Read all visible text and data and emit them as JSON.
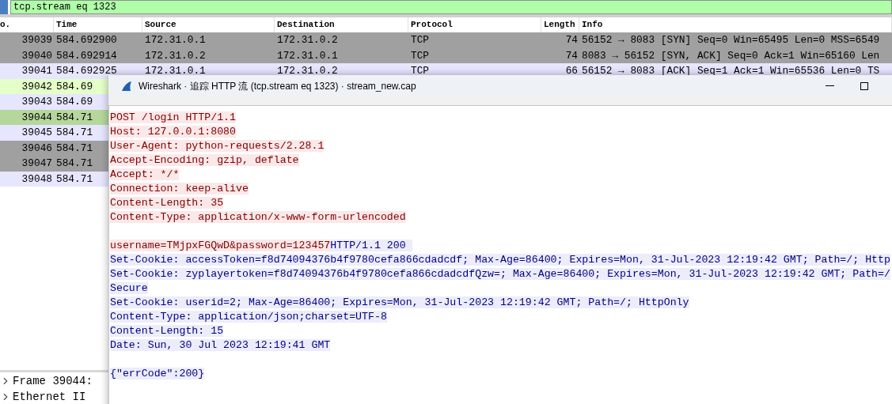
{
  "filter": {
    "value": "tcp.stream eq 1323"
  },
  "packet_list": {
    "columns": [
      "o.",
      "Time",
      "Source",
      "Destination",
      "Protocol",
      "Length",
      "Info"
    ],
    "rows": [
      {
        "no": "39039",
        "time": "584.692900",
        "source": "172.31.0.1",
        "destination": "172.31.0.2",
        "protocol": "TCP",
        "length": "74",
        "info": "56152 → 8083 [SYN] Seq=0 Win=65495 Len=0 MSS=6549",
        "color": "#a0a0a0"
      },
      {
        "no": "39040",
        "time": "584.692914",
        "source": "172.31.0.2",
        "destination": "172.31.0.1",
        "protocol": "TCP",
        "length": "74",
        "info": "8083 → 56152 [SYN, ACK] Seq=0 Ack=1 Win=65160 Len",
        "color": "#a0a0a0"
      },
      {
        "no": "39041",
        "time": "584.692925",
        "source": "172.31.0.1",
        "destination": "172.31.0.2",
        "protocol": "TCP",
        "length": "66",
        "info": "56152 → 8083 [ACK] Seq=1 Ack=1 Win=65536 Len=0 TS",
        "color": "#e7e6ff"
      },
      {
        "no": "39042",
        "time": "584.69",
        "color": "#e4ffc7"
      },
      {
        "no": "39043",
        "time": "584.69",
        "color": "#e7e6ff"
      },
      {
        "no": "39044",
        "time": "584.71",
        "color": "#b5d79c"
      },
      {
        "no": "39045",
        "time": "584.71",
        "color": "#e7e6ff"
      },
      {
        "no": "39046",
        "time": "584.71",
        "color": "#a0a0a0"
      },
      {
        "no": "39047",
        "time": "584.71",
        "color": "#a0a0a0"
      },
      {
        "no": "39048",
        "time": "584.71",
        "color": "#e7e6ff"
      }
    ]
  },
  "details": [
    {
      "label": "Frame 39044:",
      "expanded": false
    },
    {
      "label": "Ethernet II",
      "expanded": false
    }
  ],
  "dialog": {
    "title": "Wireshark · 追踪 HTTP 流 (tcp.stream eq 1323) · stream_new.cap",
    "lines": [
      {
        "kind": "text",
        "segments": [
          {
            "text": "POST /login HTTP/1.1",
            "kind": "client"
          }
        ]
      },
      {
        "kind": "text",
        "segments": [
          {
            "text": "Host: 127.0.0.1:8080",
            "kind": "client"
          }
        ]
      },
      {
        "kind": "text",
        "segments": [
          {
            "text": "User-Agent: python-requests/2.28.1",
            "kind": "client"
          }
        ]
      },
      {
        "kind": "text",
        "segments": [
          {
            "text": "Accept-Encoding: gzip, deflate",
            "kind": "client"
          }
        ]
      },
      {
        "kind": "text",
        "segments": [
          {
            "text": "Accept: */*",
            "kind": "client"
          }
        ]
      },
      {
        "kind": "text",
        "segments": [
          {
            "text": "Connection: keep-alive",
            "kind": "client"
          }
        ]
      },
      {
        "kind": "text",
        "segments": [
          {
            "text": "Content-Length: 35",
            "kind": "client"
          }
        ]
      },
      {
        "kind": "text",
        "segments": [
          {
            "text": "Content-Type: application/x-www-form-urlencoded",
            "kind": "client"
          }
        ]
      },
      {
        "kind": "blank"
      },
      {
        "kind": "text",
        "segments": [
          {
            "text": "username=TMjpxFGQwD&password=123457",
            "kind": "client"
          },
          {
            "text": "HTTP/1.1 200 ",
            "kind": "server"
          }
        ]
      },
      {
        "kind": "text",
        "segments": [
          {
            "text": "Set-Cookie: accessToken=f8d74094376b4f9780cefa866cdadcdf; Max-Age=86400; Expires=Mon, 31-Jul-2023 12:19:42 GMT; Path=/; Http",
            "kind": "server"
          }
        ]
      },
      {
        "kind": "text",
        "segments": [
          {
            "text": "Set-Cookie: zyplayertoken=f8d74094376b4f9780cefa866cdadcdfQzw=; Max-Age=86400; Expires=Mon, 31-Jul-2023 12:19:42 GMT; Path=/",
            "kind": "server"
          }
        ]
      },
      {
        "kind": "text",
        "segments": [
          {
            "text": "Secure",
            "kind": "server"
          }
        ]
      },
      {
        "kind": "text",
        "segments": [
          {
            "text": "Set-Cookie: userid=2; Max-Age=86400; Expires=Mon, 31-Jul-2023 12:19:42 GMT; Path=/; HttpOnly",
            "kind": "server"
          }
        ]
      },
      {
        "kind": "text",
        "segments": [
          {
            "text": "Content-Type: application/json;charset=UTF-8",
            "kind": "server"
          }
        ]
      },
      {
        "kind": "text",
        "segments": [
          {
            "text": "Content-Length: 15",
            "kind": "server"
          }
        ]
      },
      {
        "kind": "text",
        "segments": [
          {
            "text": "Date: Sun, 30 Jul 2023 12:19:41 GMT",
            "kind": "server"
          }
        ]
      },
      {
        "kind": "blank"
      },
      {
        "kind": "text",
        "segments": [
          {
            "text": "{\"errCode\":200}",
            "kind": "server"
          }
        ]
      }
    ]
  }
}
